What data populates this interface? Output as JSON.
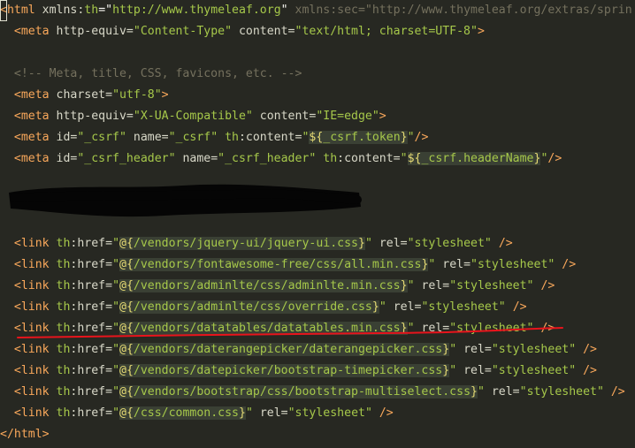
{
  "editor": {
    "lines": [
      {
        "id": "l1",
        "segments": [
          {
            "t": "<",
            "c": "tag cursor-bracket"
          },
          {
            "t": "html",
            "c": "tag"
          },
          {
            "t": " xmlns:",
            "c": "attr"
          },
          {
            "t": "th",
            "c": "ns"
          },
          {
            "t": "=\"",
            "c": "punct"
          },
          {
            "t": "http://www.thymeleaf.org",
            "c": "str"
          },
          {
            "t": "\"",
            "c": "punct"
          },
          {
            "t": " xmlns:sec=\"http://www.thymeleaf.org/extras/sprin",
            "c": "comment"
          }
        ]
      },
      {
        "id": "l2",
        "segments": [
          {
            "t": "  <",
            "c": "tag"
          },
          {
            "t": "meta",
            "c": "tag"
          },
          {
            "t": " http-equiv=",
            "c": "attr"
          },
          {
            "t": "\"Content-Type\"",
            "c": "str"
          },
          {
            "t": " content=",
            "c": "attr"
          },
          {
            "t": "\"text/html; charset=UTF-8\"",
            "c": "str"
          },
          {
            "t": ">",
            "c": "tag"
          }
        ]
      },
      {
        "id": "l3",
        "segments": []
      },
      {
        "id": "l4",
        "segments": [
          {
            "t": "  <!-- Meta, title, CSS, favicons, etc. -->",
            "c": "comment"
          }
        ]
      },
      {
        "id": "l5",
        "segments": [
          {
            "t": "  <",
            "c": "tag"
          },
          {
            "t": "meta",
            "c": "tag"
          },
          {
            "t": " charset=",
            "c": "attr"
          },
          {
            "t": "\"utf-8\"",
            "c": "str"
          },
          {
            "t": ">",
            "c": "tag"
          }
        ]
      },
      {
        "id": "l6",
        "segments": [
          {
            "t": "  <",
            "c": "tag"
          },
          {
            "t": "meta",
            "c": "tag"
          },
          {
            "t": " http-equiv=",
            "c": "attr"
          },
          {
            "t": "\"X-UA-Compatible\"",
            "c": "str"
          },
          {
            "t": " content=",
            "c": "attr"
          },
          {
            "t": "\"IE=edge\"",
            "c": "str"
          },
          {
            "t": ">",
            "c": "tag"
          }
        ]
      },
      {
        "id": "l7",
        "segments": [
          {
            "t": "  <",
            "c": "tag"
          },
          {
            "t": "meta",
            "c": "tag"
          },
          {
            "t": " id=",
            "c": "attr"
          },
          {
            "t": "\"_csrf\"",
            "c": "str"
          },
          {
            "t": " name=",
            "c": "attr"
          },
          {
            "t": "\"_csrf\"",
            "c": "str"
          },
          {
            "t": " th",
            "c": "ns"
          },
          {
            "t": ":content=",
            "c": "attr"
          },
          {
            "t": "\"",
            "c": "str"
          },
          {
            "t": "${",
            "c": "expr hl"
          },
          {
            "t": "_csrf.token",
            "c": "exprtext hl"
          },
          {
            "t": "}",
            "c": "expr hl"
          },
          {
            "t": "\"",
            "c": "str"
          },
          {
            "t": "/>",
            "c": "tag"
          }
        ]
      },
      {
        "id": "l8",
        "segments": [
          {
            "t": "  <",
            "c": "tag"
          },
          {
            "t": "meta",
            "c": "tag"
          },
          {
            "t": " id=",
            "c": "attr"
          },
          {
            "t": "\"_csrf_header\"",
            "c": "str"
          },
          {
            "t": " name=",
            "c": "attr"
          },
          {
            "t": "\"_csrf_header\"",
            "c": "str"
          },
          {
            "t": " th",
            "c": "ns"
          },
          {
            "t": ":content=",
            "c": "attr"
          },
          {
            "t": "\"",
            "c": "str"
          },
          {
            "t": "${",
            "c": "expr hl"
          },
          {
            "t": "_csrf.headerName",
            "c": "exprtext hl"
          },
          {
            "t": "}",
            "c": "expr hl"
          },
          {
            "t": "\"",
            "c": "str"
          },
          {
            "t": "/>",
            "c": "tag"
          }
        ]
      },
      {
        "id": "l9",
        "segments": []
      },
      {
        "id": "l10",
        "segments": []
      },
      {
        "id": "l11",
        "segments": []
      },
      {
        "id": "l12",
        "segments": [
          {
            "t": "  <",
            "c": "tag"
          },
          {
            "t": "link",
            "c": "tag"
          },
          {
            "t": " th",
            "c": "ns"
          },
          {
            "t": ":href=",
            "c": "attr"
          },
          {
            "t": "\"",
            "c": "str"
          },
          {
            "t": "@{",
            "c": "expr hl"
          },
          {
            "t": "/vendors/jquery-ui/jquery-ui.css",
            "c": "exprtext hl"
          },
          {
            "t": "}",
            "c": "expr hl"
          },
          {
            "t": "\"",
            "c": "str"
          },
          {
            "t": " rel=",
            "c": "attr"
          },
          {
            "t": "\"stylesheet\"",
            "c": "str"
          },
          {
            "t": " />",
            "c": "tag"
          }
        ]
      },
      {
        "id": "l13",
        "segments": [
          {
            "t": "  <",
            "c": "tag"
          },
          {
            "t": "link",
            "c": "tag"
          },
          {
            "t": " th",
            "c": "ns"
          },
          {
            "t": ":href=",
            "c": "attr"
          },
          {
            "t": "\"",
            "c": "str"
          },
          {
            "t": "@{",
            "c": "expr hl"
          },
          {
            "t": "/vendors/fontawesome-free/css/all.min.css",
            "c": "exprtext hl"
          },
          {
            "t": "}",
            "c": "expr hl"
          },
          {
            "t": "\"",
            "c": "str"
          },
          {
            "t": " rel=",
            "c": "attr"
          },
          {
            "t": "\"stylesheet\"",
            "c": "str"
          },
          {
            "t": " />",
            "c": "tag"
          }
        ]
      },
      {
        "id": "l14",
        "segments": [
          {
            "t": "  <",
            "c": "tag"
          },
          {
            "t": "link",
            "c": "tag"
          },
          {
            "t": " th",
            "c": "ns"
          },
          {
            "t": ":href=",
            "c": "attr"
          },
          {
            "t": "\"",
            "c": "str"
          },
          {
            "t": "@{",
            "c": "expr hl"
          },
          {
            "t": "/vendors/adminlte/css/adminlte.min.css",
            "c": "exprtext hl"
          },
          {
            "t": "}",
            "c": "expr hl"
          },
          {
            "t": "\"",
            "c": "str"
          },
          {
            "t": " rel=",
            "c": "attr"
          },
          {
            "t": "\"stylesheet\"",
            "c": "str"
          },
          {
            "t": " />",
            "c": "tag"
          }
        ]
      },
      {
        "id": "l15",
        "segments": [
          {
            "t": "  <",
            "c": "tag"
          },
          {
            "t": "link",
            "c": "tag"
          },
          {
            "t": " th",
            "c": "ns"
          },
          {
            "t": ":href=",
            "c": "attr"
          },
          {
            "t": "\"",
            "c": "str"
          },
          {
            "t": "@{",
            "c": "expr hl"
          },
          {
            "t": "/vendors/adminlte/css/override.css",
            "c": "exprtext hl"
          },
          {
            "t": "}",
            "c": "expr hl"
          },
          {
            "t": "\"",
            "c": "str"
          },
          {
            "t": " rel=",
            "c": "attr"
          },
          {
            "t": "\"stylesheet\"",
            "c": "str"
          },
          {
            "t": " />",
            "c": "tag"
          }
        ]
      },
      {
        "id": "l16",
        "segments": [
          {
            "t": "  <",
            "c": "tag"
          },
          {
            "t": "link",
            "c": "tag"
          },
          {
            "t": " th",
            "c": "ns"
          },
          {
            "t": ":href=",
            "c": "attr"
          },
          {
            "t": "\"",
            "c": "str"
          },
          {
            "t": "@{",
            "c": "expr hl"
          },
          {
            "t": "/vendors/datatables/datatables.min.css",
            "c": "exprtext hl"
          },
          {
            "t": "}",
            "c": "expr hl"
          },
          {
            "t": "\"",
            "c": "str"
          },
          {
            "t": " rel=",
            "c": "attr"
          },
          {
            "t": "\"stylesheet\"",
            "c": "str"
          },
          {
            "t": " />",
            "c": "tag"
          }
        ]
      },
      {
        "id": "l17",
        "segments": [
          {
            "t": "  <",
            "c": "tag"
          },
          {
            "t": "link",
            "c": "tag"
          },
          {
            "t": " th",
            "c": "ns"
          },
          {
            "t": ":href=",
            "c": "attr"
          },
          {
            "t": "\"",
            "c": "str"
          },
          {
            "t": "@{",
            "c": "expr hl"
          },
          {
            "t": "/vendors/daterangepicker/daterangepicker.css",
            "c": "exprtext hl"
          },
          {
            "t": "}",
            "c": "expr hl"
          },
          {
            "t": "\"",
            "c": "str"
          },
          {
            "t": " rel=",
            "c": "attr"
          },
          {
            "t": "\"stylesheet\"",
            "c": "str"
          },
          {
            "t": " />",
            "c": "tag"
          }
        ]
      },
      {
        "id": "l18",
        "segments": [
          {
            "t": "  <",
            "c": "tag"
          },
          {
            "t": "link",
            "c": "tag"
          },
          {
            "t": " th",
            "c": "ns"
          },
          {
            "t": ":href=",
            "c": "attr"
          },
          {
            "t": "\"",
            "c": "str"
          },
          {
            "t": "@{",
            "c": "expr hl"
          },
          {
            "t": "/vendors/datepicker/bootstrap-timepicker.css",
            "c": "exprtext hl"
          },
          {
            "t": "}",
            "c": "expr hl"
          },
          {
            "t": "\"",
            "c": "str"
          },
          {
            "t": " rel=",
            "c": "attr"
          },
          {
            "t": "\"stylesheet\"",
            "c": "str"
          },
          {
            "t": " />",
            "c": "tag"
          }
        ]
      },
      {
        "id": "l19",
        "segments": [
          {
            "t": "  <",
            "c": "tag"
          },
          {
            "t": "link",
            "c": "tag"
          },
          {
            "t": " th",
            "c": "ns"
          },
          {
            "t": ":href=",
            "c": "attr"
          },
          {
            "t": "\"",
            "c": "str"
          },
          {
            "t": "@{",
            "c": "expr hl"
          },
          {
            "t": "/vendors/bootstrap/css/bootstrap-multiselect.css",
            "c": "exprtext hl"
          },
          {
            "t": "}",
            "c": "expr hl"
          },
          {
            "t": "\"",
            "c": "str"
          },
          {
            "t": " rel=",
            "c": "attr"
          },
          {
            "t": "\"stylesheet\"",
            "c": "str"
          },
          {
            "t": " />",
            "c": "tag"
          }
        ]
      },
      {
        "id": "l20",
        "segments": [
          {
            "t": "  <",
            "c": "tag"
          },
          {
            "t": "link",
            "c": "tag"
          },
          {
            "t": " th",
            "c": "ns"
          },
          {
            "t": ":href=",
            "c": "attr"
          },
          {
            "t": "\"",
            "c": "str"
          },
          {
            "t": "@{",
            "c": "expr hl"
          },
          {
            "t": "/css/common.css",
            "c": "exprtext hl"
          },
          {
            "t": "}",
            "c": "expr hl"
          },
          {
            "t": "\"",
            "c": "str"
          },
          {
            "t": " rel=",
            "c": "attr"
          },
          {
            "t": "\"stylesheet\"",
            "c": "str"
          },
          {
            "t": " />",
            "c": "tag"
          }
        ]
      },
      {
        "id": "l21",
        "segments": [
          {
            "t": "</",
            "c": "tag"
          },
          {
            "t": "html",
            "c": "tag"
          },
          {
            "t": ">",
            "c": "tag"
          }
        ]
      }
    ]
  },
  "colors": {
    "background": "#272822",
    "tag": "#f9a85b",
    "string": "#a6c84a",
    "comment": "#75715e",
    "annotation_red": "#e8141c",
    "redaction": "#050505"
  }
}
